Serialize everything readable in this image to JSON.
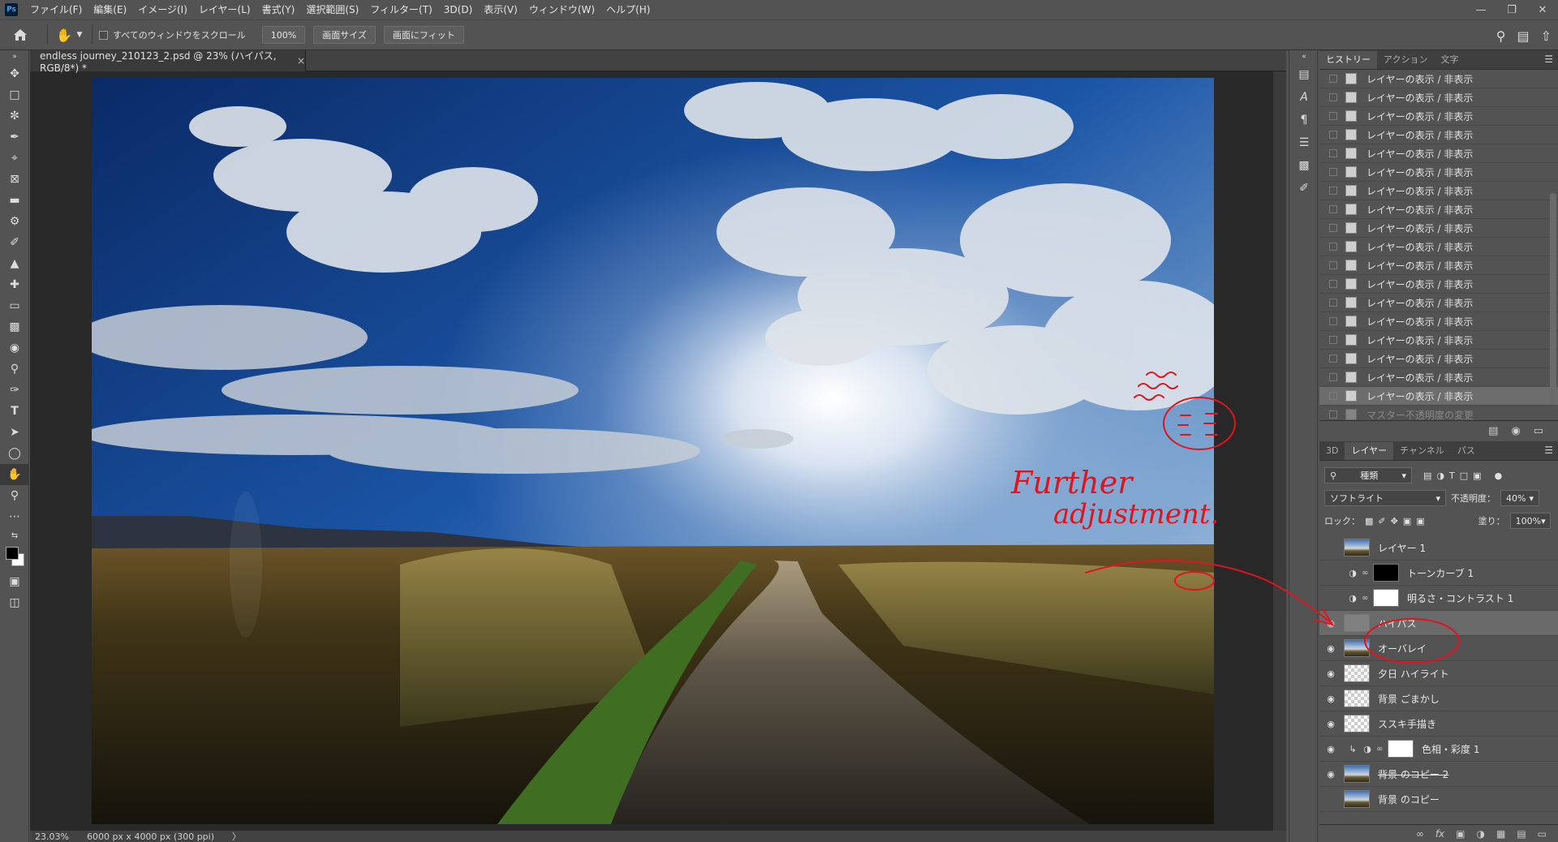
{
  "app": {
    "logo": "Ps"
  },
  "menu": [
    "ファイル(F)",
    "編集(E)",
    "イメージ(I)",
    "レイヤー(L)",
    "書式(Y)",
    "選択範囲(S)",
    "フィルター(T)",
    "3D(D)",
    "表示(V)",
    "ウィンドウ(W)",
    "ヘルプ(H)"
  ],
  "options": {
    "scroll_all_label": "すべてのウィンドウをスクロール",
    "zoom_100": "100%",
    "fit_screen_size": "画面サイズ",
    "fit_screen": "画面にフィット"
  },
  "document": {
    "tab_title": "endless journey_210123_2.psd @ 23% (ハイパス, RGB/8*) *",
    "tab_close": "×"
  },
  "status": {
    "zoom": "23.03%",
    "dimensions": "6000 px x 4000 px (300 ppi)",
    "arrow": "〉"
  },
  "history": {
    "tabs": [
      "ヒストリー",
      "アクション",
      "文字"
    ],
    "items": [
      "レイヤーの表示 / 非表示",
      "レイヤーの表示 / 非表示",
      "レイヤーの表示 / 非表示",
      "レイヤーの表示 / 非表示",
      "レイヤーの表示 / 非表示",
      "レイヤーの表示 / 非表示",
      "レイヤーの表示 / 非表示",
      "レイヤーの表示 / 非表示",
      "レイヤーの表示 / 非表示",
      "レイヤーの表示 / 非表示",
      "レイヤーの表示 / 非表示",
      "レイヤーの表示 / 非表示",
      "レイヤーの表示 / 非表示",
      "レイヤーの表示 / 非表示",
      "レイヤーの表示 / 非表示",
      "レイヤーの表示 / 非表示",
      "レイヤーの表示 / 非表示",
      "レイヤーの表示 / 非表示"
    ],
    "last_item": "マスター不透明度の変更"
  },
  "layers": {
    "tabs": [
      "3D",
      "レイヤー",
      "チャンネル",
      "パス"
    ],
    "filter_kind": "種類",
    "blend_mode": "ソフトライト",
    "opacity_label": "不透明度：",
    "opacity_value": "40%",
    "lock_label": "ロック：",
    "fill_label": "塗り：",
    "fill_value": "100%",
    "items": [
      {
        "name": "レイヤー 1",
        "visible": false,
        "thumb": "photo"
      },
      {
        "name": "トーンカーブ 1",
        "visible": false,
        "thumb": "black",
        "adjustment": true
      },
      {
        "name": "明るさ・コントラスト 1",
        "visible": false,
        "thumb": "white",
        "adjustment": true
      },
      {
        "name": "ハイパス",
        "visible": true,
        "thumb": "gray",
        "selected": true
      },
      {
        "name": "オーバレイ",
        "visible": true,
        "thumb": "photo"
      },
      {
        "name": "夕日 ハイライト",
        "visible": true,
        "thumb": "check"
      },
      {
        "name": "背景 ごまかし",
        "visible": true,
        "thumb": "check"
      },
      {
        "name": "ススキ手描き",
        "visible": true,
        "thumb": "check"
      },
      {
        "name": "色相・彩度 1",
        "visible": true,
        "thumb": "white",
        "adjustment": true,
        "clipped": true
      },
      {
        "name": "背景 のコピー 2",
        "visible": true,
        "thumb": "photo",
        "strike": true
      },
      {
        "name": "背景 のコピー",
        "visible": false,
        "thumb": "photo"
      }
    ]
  },
  "annotation": {
    "line1": "Further",
    "line2": "adjustment.",
    "color": "#e0141e"
  },
  "icons": [
    "home-icon",
    "hand-icon",
    "search-icon",
    "workspace-icon",
    "share-icon",
    "move-icon",
    "marquee-icon",
    "lasso-icon",
    "quick-select-icon",
    "crop-icon",
    "frame-icon",
    "ruler-icon",
    "patch-icon",
    "brush-icon",
    "stamp-icon",
    "history-brush-icon",
    "eraser-icon",
    "gradient-icon",
    "blur-icon",
    "dodge-icon",
    "pen-icon",
    "type-icon",
    "path-select-icon",
    "ellipse-icon",
    "zoom-icon",
    "more-icon",
    "eye-icon",
    "trash-icon",
    "camera-icon",
    "link-icon"
  ]
}
